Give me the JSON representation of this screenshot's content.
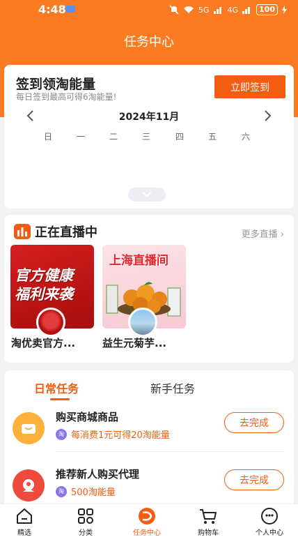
{
  "status": {
    "time": "4:48",
    "signal1": "5G",
    "signal2": "4G",
    "battery": "100"
  },
  "header": {
    "title": "任务中心"
  },
  "signin": {
    "title": "签到领淘能量",
    "subtitle": "每日签到最高可得6淘能量!",
    "button": "立即签到",
    "month": "2024年11月",
    "weekdays": [
      "日",
      "一",
      "二",
      "三",
      "四",
      "五",
      "六"
    ]
  },
  "live": {
    "title": "正在直播中",
    "more": "更多直播 ›",
    "items": [
      {
        "name": "淘优卖官方...",
        "banner_line1": "官方健康",
        "banner_line2": "福利来袭"
      },
      {
        "name": "益生元菊芋...",
        "banner_line1": "上海直播间"
      }
    ]
  },
  "tasks": {
    "tabs": [
      "日常任务",
      "新手任务"
    ],
    "items": [
      {
        "title": "购买商城商品",
        "reward": "每消费1元可得20淘能量",
        "button": "去完成"
      },
      {
        "title": "推荐新人购买代理",
        "reward": "500淘能量",
        "button": "去完成"
      }
    ]
  },
  "nav": [
    "精选",
    "分类",
    "任务中心",
    "购物车",
    "个人中心"
  ],
  "colors": {
    "brand": "#fb7b22",
    "accent": "#f35d12"
  }
}
